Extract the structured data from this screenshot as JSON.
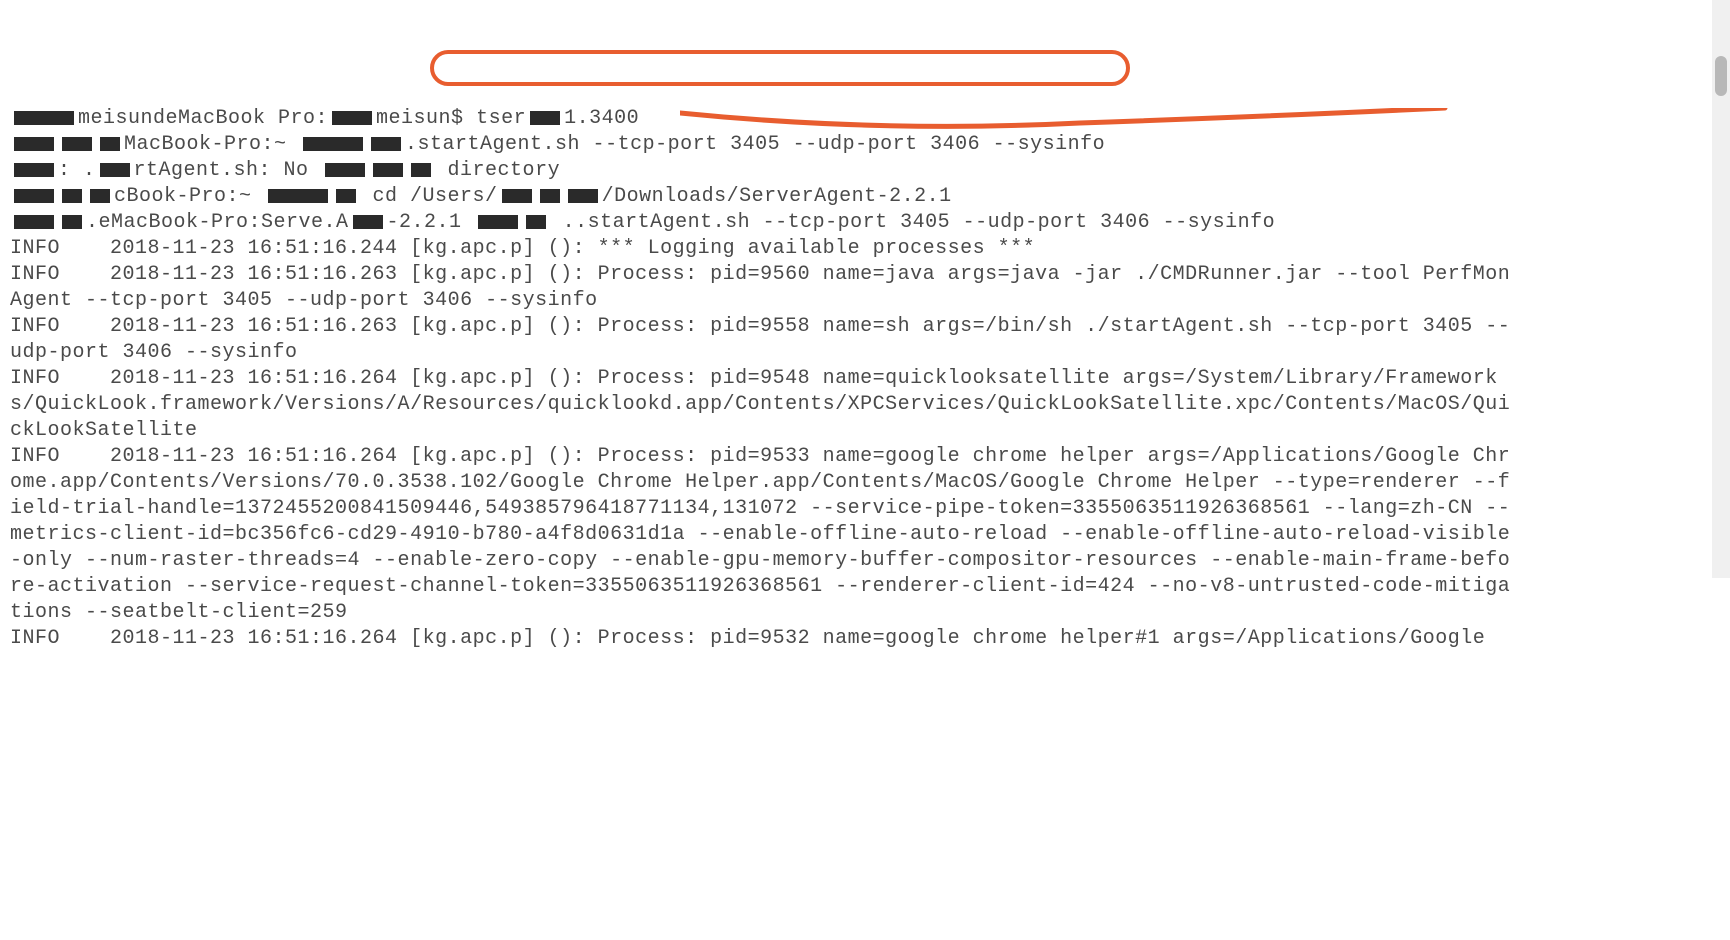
{
  "terminal": {
    "lines": [
      {
        "segments": [
          {
            "t": "redact",
            "w": "w60"
          },
          {
            "t": "text",
            "v": "meisundeMacBook Pro:"
          },
          {
            "t": "redact",
            "w": "w40"
          },
          {
            "t": "text",
            "v": "meisun$ tser"
          },
          {
            "t": "redact",
            "w": "w30"
          },
          {
            "t": "text",
            "v": "1.3400"
          }
        ]
      },
      {
        "segments": [
          {
            "t": "redact",
            "w": "w40"
          },
          {
            "t": "redact",
            "w": "w30"
          },
          {
            "t": "redact",
            "w": "w20"
          },
          {
            "t": "text",
            "v": "MacBook-Pro:~ "
          },
          {
            "t": "redact",
            "w": "w60"
          },
          {
            "t": "redact",
            "w": "w30"
          },
          {
            "t": "text",
            "v": ".startAgent.sh --tcp-port 3405 --udp-port 3406 --sysinfo"
          }
        ]
      },
      {
        "segments": [
          {
            "t": "redact",
            "w": "w40"
          },
          {
            "t": "text",
            "v": ": ."
          },
          {
            "t": "redact",
            "w": "w30"
          },
          {
            "t": "text",
            "v": "rtAgent.sh: No "
          },
          {
            "t": "redact",
            "w": "w40"
          },
          {
            "t": "redact",
            "w": "w30"
          },
          {
            "t": "redact",
            "w": "w20"
          },
          {
            "t": "text",
            "v": " directory"
          }
        ]
      },
      {
        "segments": [
          {
            "t": "redact",
            "w": "w40"
          },
          {
            "t": "redact",
            "w": "w20"
          },
          {
            "t": "redact",
            "w": "w20"
          },
          {
            "t": "text",
            "v": "cBook-Pro:~ "
          },
          {
            "t": "redact",
            "w": "w60"
          },
          {
            "t": "redact",
            "w": "w20"
          },
          {
            "t": "text",
            "v": " cd /Users/"
          },
          {
            "t": "redact",
            "w": "w30"
          },
          {
            "t": "redact",
            "w": "w20"
          },
          {
            "t": "redact",
            "w": "w30"
          },
          {
            "t": "text",
            "v": "/Downloads/ServerAgent-2.2.1"
          }
        ]
      },
      {
        "segments": [
          {
            "t": "redact",
            "w": "w40"
          },
          {
            "t": "redact",
            "w": "w20"
          },
          {
            "t": "text",
            "v": ".eMacBook-Pro:Serve.A"
          },
          {
            "t": "redact",
            "w": "w30"
          },
          {
            "t": "text",
            "v": "-2.2.1 "
          },
          {
            "t": "redact",
            "w": "w40"
          },
          {
            "t": "redact",
            "w": "w20"
          },
          {
            "t": "text",
            "v": " ..startAgent.sh --tcp-port 3405 --udp-port 3406 --sysinfo"
          }
        ]
      },
      {
        "segments": [
          {
            "t": "text",
            "v": "INFO    2018-11-23 16:51:16.244 [kg.apc.p] (): *** Logging available processes ***"
          }
        ]
      },
      {
        "segments": [
          {
            "t": "text",
            "v": "INFO    2018-11-23 16:51:16.263 [kg.apc.p] (): Process: pid=9560 name=java args=java -jar ./CMDRunner.jar --tool PerfMonAgent --tcp-port 3405 --udp-port 3406 --sysinfo"
          }
        ]
      },
      {
        "segments": [
          {
            "t": "text",
            "v": "INFO    2018-11-23 16:51:16.263 [kg.apc.p] (): Process: pid=9558 name=sh args=/bin/sh ./startAgent.sh --tcp-port 3405 --udp-port 3406 --sysinfo"
          }
        ]
      },
      {
        "segments": [
          {
            "t": "text",
            "v": "INFO    2018-11-23 16:51:16.264 [kg.apc.p] (): Process: pid=9548 name=quicklooksatellite args=/System/Library/Frameworks/QuickLook.framework/Versions/A/Resources/quicklookd.app/Contents/XPCServices/QuickLookSatellite.xpc/Contents/MacOS/QuickLookSatellite"
          }
        ]
      },
      {
        "segments": [
          {
            "t": "text",
            "v": "INFO    2018-11-23 16:51:16.264 [kg.apc.p] (): Process: pid=9533 name=google chrome helper args=/Applications/Google Chrome.app/Contents/Versions/70.0.3538.102/Google Chrome Helper.app/Contents/MacOS/Google Chrome Helper --type=renderer --field-trial-handle=1372455200841509446,549385796418771134,131072 --service-pipe-token=3355063511926368561 --lang=zh-CN --metrics-client-id=bc356fc6-cd29-4910-b780-a4f8d0631d1a --enable-offline-auto-reload --enable-offline-auto-reload-visible-only --num-raster-threads=4 --enable-zero-copy --enable-gpu-memory-buffer-compositor-resources --enable-main-frame-before-activation --service-request-channel-token=3355063511926368561 --renderer-client-id=424 --no-v8-untrusted-code-mitigations --seatbelt-client=259"
          }
        ]
      },
      {
        "segments": [
          {
            "t": "text",
            "v": "INFO    2018-11-23 16:51:16.264 [kg.apc.p] (): Process: pid=9532 name=google chrome helper#1 args=/Applications/Google"
          }
        ]
      }
    ]
  },
  "annotations": {
    "highlight_command": "cd /Users/.../Downloads/ServerAgent-2.2.1",
    "color": "#e85d2f"
  },
  "scrollbar": {
    "visible": true
  }
}
